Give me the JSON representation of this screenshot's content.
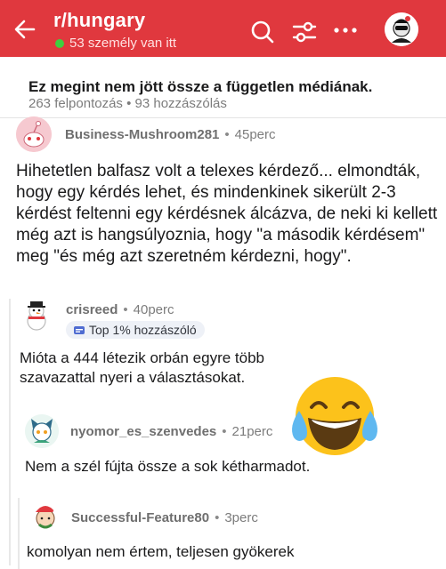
{
  "header": {
    "subreddit": "r/hungary",
    "online": "53 személy van itt",
    "icons": [
      "back-arrow-icon",
      "search-icon",
      "filter-icon",
      "more-icon"
    ]
  },
  "post": {
    "title": "Ez megint nem jött össze a független médiának.",
    "meta": "263 felpontozás • 93 hozzászólás"
  },
  "comments": [
    {
      "user": "Business-Mushroom281",
      "age": "45perc",
      "body": "Hihetetlen balfasz volt a telexes kérdező... elmondták, hogy egy kérdés lehet, és mindenkinek sikerült 2-3 kérdést feltenni egy kérdésnek álcázva, de neki ki kellett még azt is hangsúlyoznia, hogy \"a második kérdésem\" meg \"és még azt szeretném kérdezni, hogy\"."
    },
    {
      "user": "crisreed",
      "age": "40perc",
      "flair": "Top 1% hozzászóló",
      "body": "Mióta a 444 létezik orbán egyre több szavazattal nyeri a választásokat."
    },
    {
      "user": "nyomor_es_szenvedes",
      "age": "21perc",
      "body": "Nem a szél fújta össze a sok kétharmadot."
    },
    {
      "user": "Successful-Feature80",
      "age": "3perc",
      "body": "komolyan nem értem, teljesen gyökerek"
    }
  ],
  "colors": {
    "header_bg": "#e0383e",
    "online_dot": "#3ecf3e"
  }
}
